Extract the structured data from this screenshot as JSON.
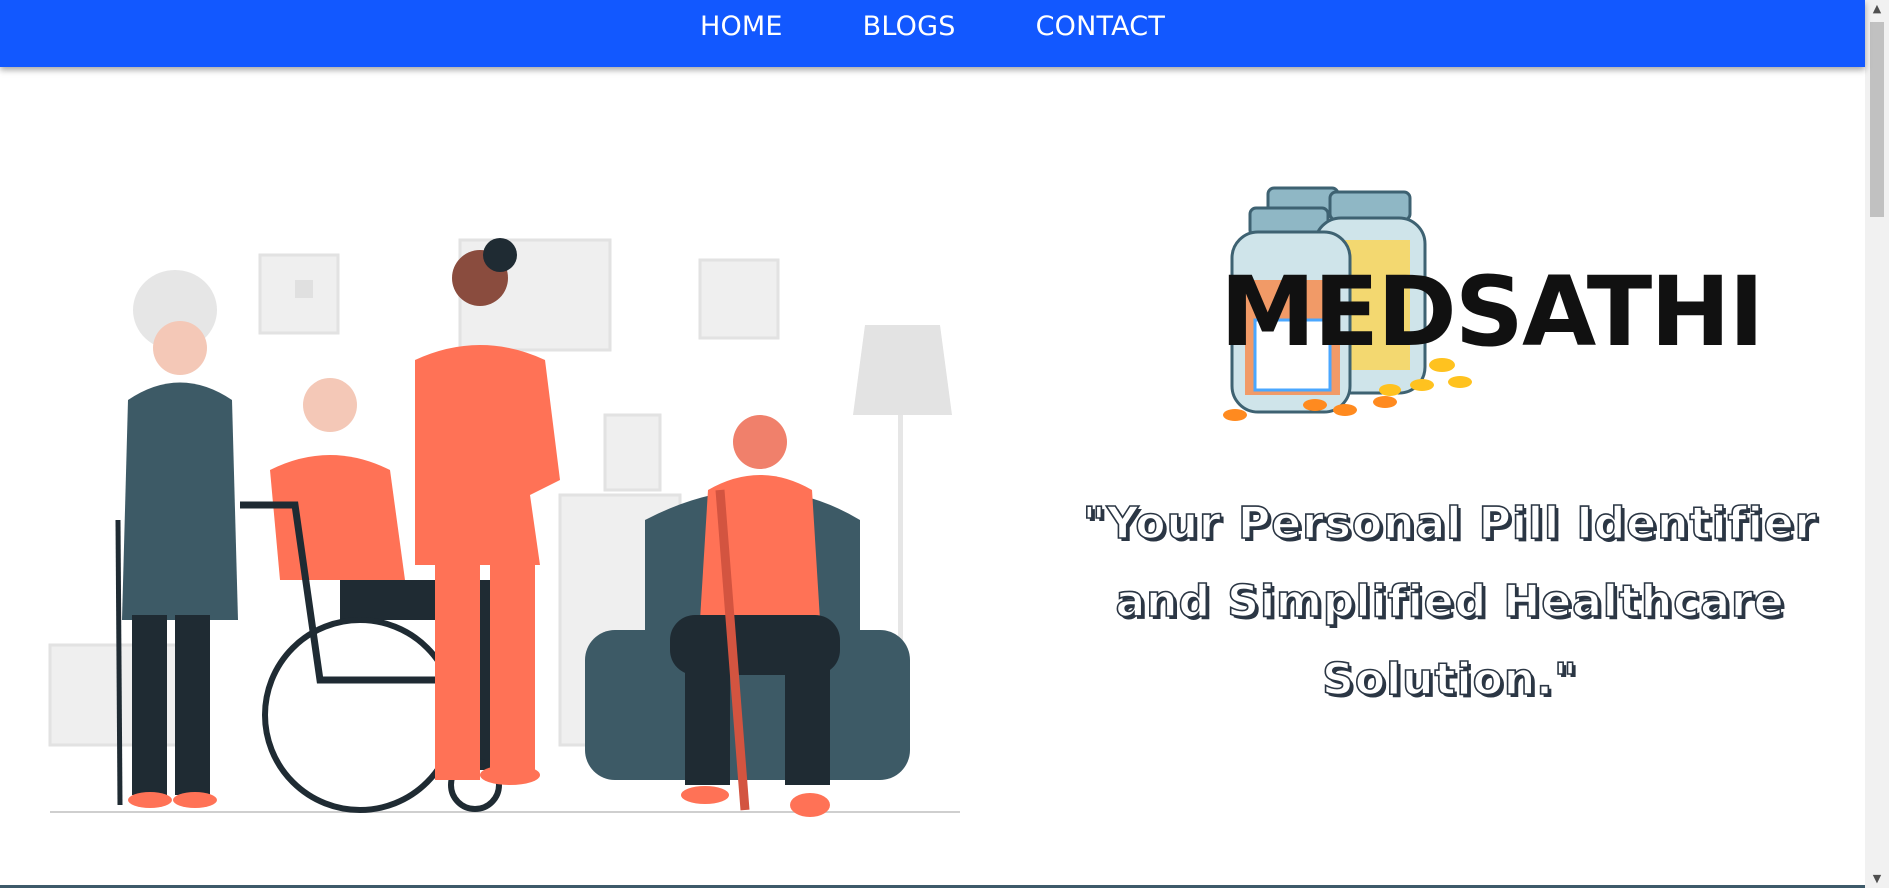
{
  "nav": {
    "items": [
      {
        "label": "HOME"
      },
      {
        "label": "BLOGS"
      },
      {
        "label": "CONTACT"
      }
    ]
  },
  "brand": {
    "logo_text": "MEDSATHI"
  },
  "hero": {
    "tagline": "\"Your Personal Pill Identifier and Simplified Healthcare Solution.\""
  },
  "colors": {
    "nav_bg": "#1258ff",
    "accent_orange": "#ff7256",
    "teal_dark": "#3d5a66",
    "navy_text": "#2b3644"
  }
}
